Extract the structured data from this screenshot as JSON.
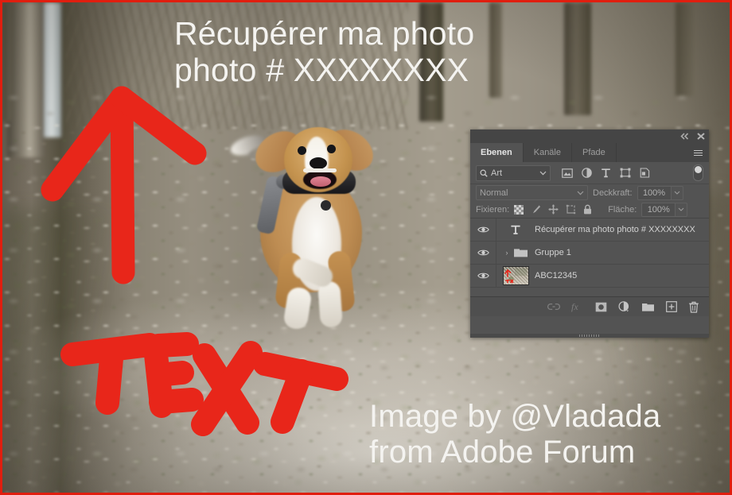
{
  "overlays": {
    "title": "Récupérer ma photo\nphoto # XXXXXXXX",
    "credit": "Image by @Vladada\nfrom Adobe Forum",
    "annotation_arrow": "red-arrow-up",
    "annotation_text": "TEXT",
    "annotation_color": "#e8261a"
  },
  "panel": {
    "title_bar": {
      "collapse_label": "«",
      "close_label": "✕"
    },
    "tabs": [
      {
        "label": "Ebenen",
        "active": true
      },
      {
        "label": "Kanäle",
        "active": false
      },
      {
        "label": "Pfade",
        "active": false
      }
    ],
    "menu_icon": "hamburger-menu-icon",
    "filter": {
      "search_icon": "search-icon",
      "value": "Art",
      "chevron": "⌄",
      "type_icons": [
        "image-filter-icon",
        "adjustment-filter-icon",
        "type-filter-icon",
        "shape-filter-icon",
        "smartobject-filter-icon"
      ],
      "toggle": "filter-enable-toggle"
    },
    "blend": {
      "mode": "Normal",
      "chevron": "⌄",
      "opacity_label": "Deckkraft:",
      "opacity_value": "100%"
    },
    "lock": {
      "label": "Fixieren:",
      "icons": [
        "lock-transparent-pixels-icon",
        "lock-image-pixels-icon",
        "lock-position-icon",
        "lock-artboard-nesting-icon",
        "lock-all-icon"
      ],
      "fill_label": "Fläche:",
      "fill_value": "100%"
    },
    "layers": [
      {
        "name": "Récupérer ma photo photo # XXXXXXXX",
        "kind": "text",
        "icon": "text-layer-icon",
        "visible": true,
        "eye_icon": "eye-icon"
      },
      {
        "name": "Gruppe 1",
        "kind": "group",
        "icon": "folder-icon",
        "disclosure": "›",
        "visible": true,
        "eye_icon": "eye-icon"
      },
      {
        "name": "ABC12345",
        "kind": "image",
        "icon": "layer-thumbnail",
        "visible": true,
        "eye_icon": "eye-icon"
      }
    ],
    "bottom_bar": [
      {
        "name": "link-layers-icon",
        "label": "link",
        "disabled": true
      },
      {
        "name": "layer-style-fx-icon",
        "label": "fx",
        "disabled": true
      },
      {
        "name": "layer-mask-icon",
        "label": "mask",
        "disabled": false
      },
      {
        "name": "adjustment-layer-icon",
        "label": "adjustment",
        "disabled": false
      },
      {
        "name": "new-group-icon",
        "label": "group",
        "disabled": false
      },
      {
        "name": "new-layer-icon",
        "label": "new",
        "disabled": false
      },
      {
        "name": "delete-layer-icon",
        "label": "delete",
        "disabled": false
      }
    ]
  },
  "colors": {
    "panel_bg": "#535353",
    "panel_header": "#454545",
    "panel_footer": "#4f4f4f",
    "border_red": "#e01e0f",
    "annotation_red": "#e8261a",
    "overlay_text": "#f4f3f0"
  }
}
